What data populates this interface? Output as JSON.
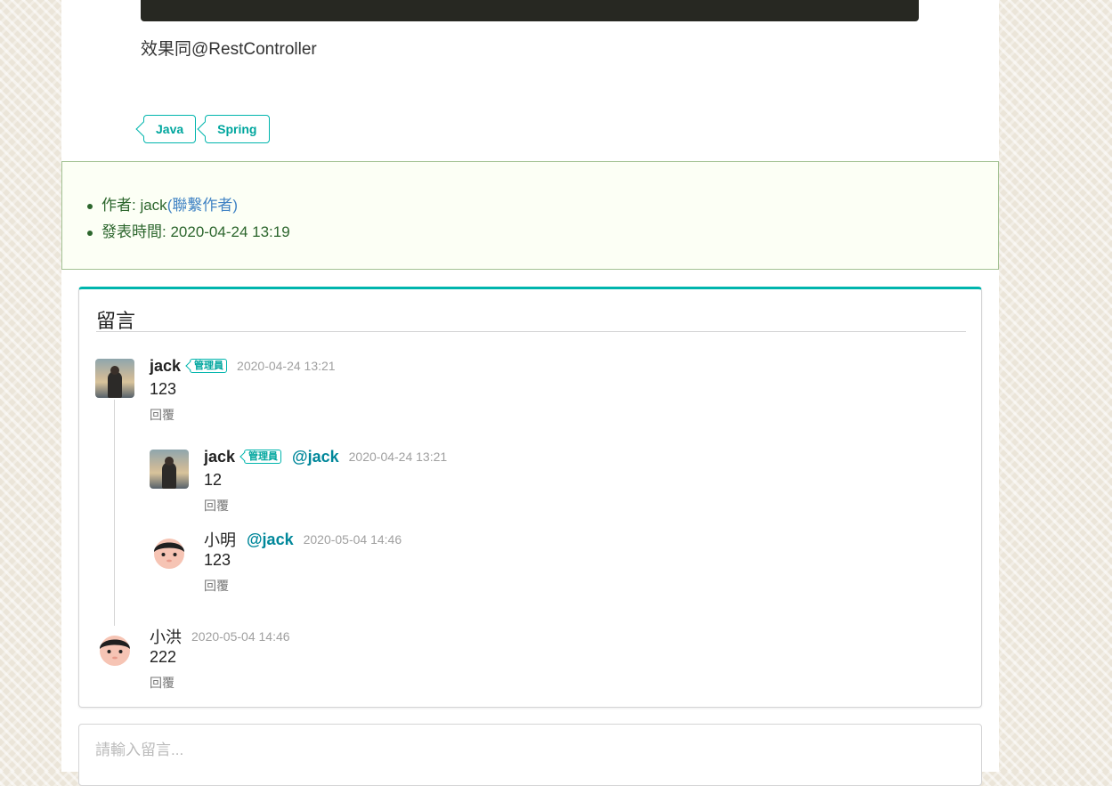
{
  "post": {
    "content_text": "效果同@RestController",
    "tags": [
      "Java",
      "Spring"
    ]
  },
  "meta": {
    "author_prefix": "作者: jack",
    "contact_link": "(聯繫作者)",
    "published_prefix": "發表時間: ",
    "published_value": "2020-04-24 13:19"
  },
  "comments": {
    "title": "留言",
    "list": [
      {
        "author": "jack",
        "badge": "管理員",
        "date": "2020-04-24 13:21",
        "text": "123",
        "reply": "回覆"
      },
      {
        "author": "jack",
        "badge": "管理員",
        "mention": "@jack",
        "date": "2020-04-24 13:21",
        "text": "12",
        "reply": "回覆"
      },
      {
        "author": "小明",
        "mention": "@jack",
        "date": "2020-05-04 14:46",
        "text": "123",
        "reply": "回覆"
      },
      {
        "author": "小洪",
        "date": "2020-05-04 14:46",
        "text": "222",
        "reply": "回覆"
      }
    ]
  },
  "input": {
    "placeholder": "請輸入留言...",
    "value": ""
  },
  "colors": {
    "accent": "#00b5ad",
    "meta_text": "#2c662d",
    "link": "#4183c4",
    "mention": "#00879a"
  }
}
